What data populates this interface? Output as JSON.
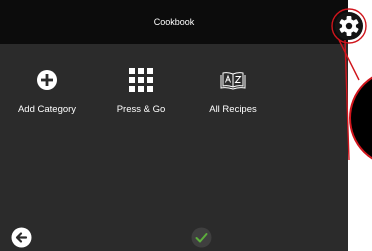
{
  "header": {
    "title": "Cookbook"
  },
  "menu": {
    "items": [
      {
        "label": "Add Category",
        "icon": "plus-circle-icon"
      },
      {
        "label": "Press & Go",
        "icon": "grid-icon"
      },
      {
        "label": "All Recipes",
        "icon": "open-book-az-icon"
      }
    ]
  },
  "footer": {
    "back_icon": "arrow-left-icon",
    "confirm_icon": "checkmark-icon"
  },
  "settings": {
    "icon": "gear-icon"
  },
  "colors": {
    "header_bg": "#0c0c0c",
    "screen_bg": "#2b2b2b",
    "text": "#ffffff",
    "confirm": "#5cae3c",
    "annotation": "#d0151c"
  }
}
